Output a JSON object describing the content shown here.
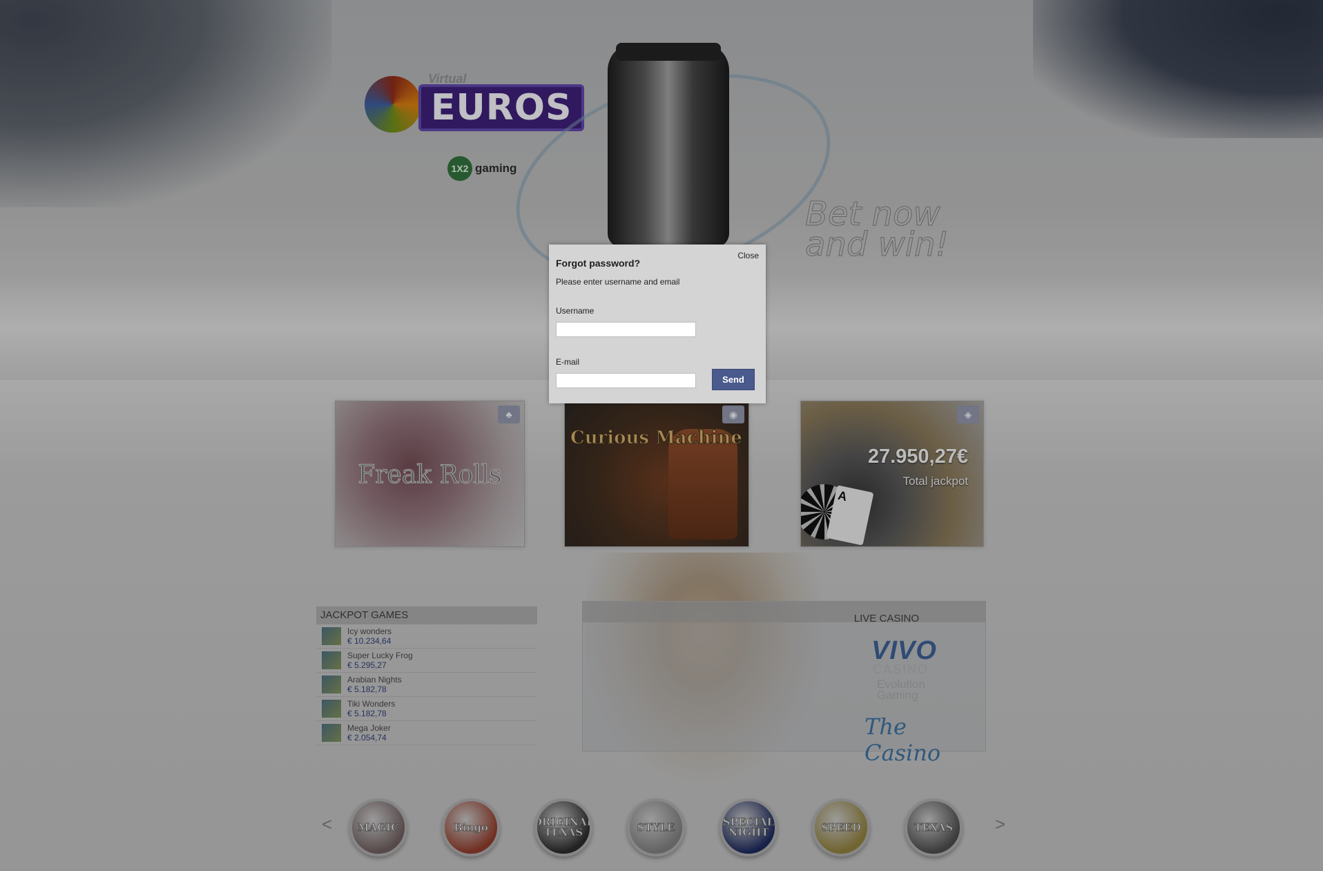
{
  "brand": {
    "virtual_label": "Virtual",
    "euros_label": "EUROS",
    "provider_badge": "1X2",
    "provider_text": "gaming"
  },
  "hero": {
    "slogan_line1": "Bet now",
    "slogan_line2": "and win!"
  },
  "promos": [
    {
      "title": "Freak Rolls",
      "tag_icon": "cards-icon"
    },
    {
      "title": "Curious Machine",
      "tag_icon": "coin-icon"
    },
    {
      "amount": "27.950,27€",
      "label": "Total jackpot",
      "card_rank": "A",
      "tag_icon": "dice-icon"
    }
  ],
  "jackpot_games": {
    "title": "JACKPOT GAMES",
    "items": [
      {
        "name": "Icy wonders",
        "amount": "€ 10.234,64"
      },
      {
        "name": "Super Lucky Frog",
        "amount": "€ 5.295,27"
      },
      {
        "name": "Arabian Nights",
        "amount": "€ 5.182,78"
      },
      {
        "name": "Tiki Wonders",
        "amount": "€ 5.182,78"
      },
      {
        "name": "Mega Joker",
        "amount": "€ 2.054,74"
      }
    ]
  },
  "live_casino": {
    "title": "LIVE CASINO",
    "vivo": "VIVO",
    "vivo_sub": "CASINO",
    "evolution_line1": "Evolution",
    "evolution_line2": "Gaming",
    "the_casino": "The Casino"
  },
  "carousel": {
    "prev": "<",
    "next": ">",
    "games": [
      {
        "label": "MAGIC",
        "color": "#6a5a5a"
      },
      {
        "label": "Bingo",
        "color": "#8a3a2a"
      },
      {
        "label": "ORIGINAL TEXAS",
        "color": "#2a2a2a"
      },
      {
        "label": "STYLE",
        "color": "#7a7a7a"
      },
      {
        "label": "SPECIAL NIGHT",
        "color": "#1e2a5a"
      },
      {
        "label": "SPEED",
        "color": "#8a7a3a"
      },
      {
        "label": "TEXAS",
        "color": "#4a4a4a"
      }
    ]
  },
  "modal": {
    "close_label": "Close",
    "title": "Forgot password?",
    "instruction": "Please enter username and email",
    "username_label": "Username",
    "username_value": "",
    "email_label": "E-mail",
    "email_value": "",
    "send_label": "Send"
  }
}
